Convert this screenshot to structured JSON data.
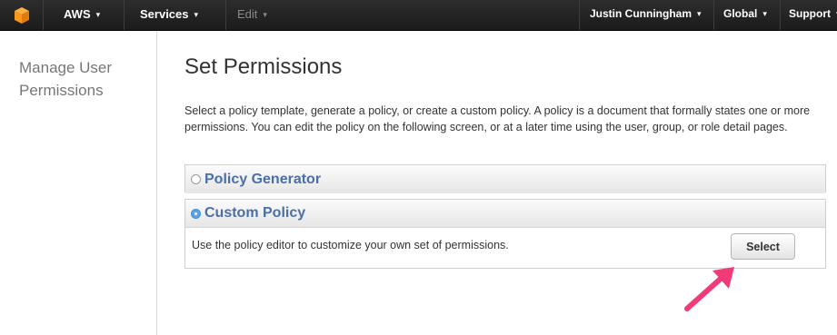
{
  "colors": {
    "nav_background": "#232323",
    "logo_orange": "#f7981d",
    "option_label": "#4a6fa8",
    "radio_selected": "#5aa3ea",
    "annotation_arrow": "#f03a7a"
  },
  "topnav": {
    "logo_icon": "aws-cube-icon",
    "aws_label": "AWS",
    "services_label": "Services",
    "edit_label": "Edit",
    "user_label": "Justin Cunningham",
    "region_label": "Global",
    "support_label": "Support",
    "caret": "▾"
  },
  "sidebar": {
    "title": "Manage User Permissions"
  },
  "main": {
    "title": "Set Permissions",
    "intro": "Select a policy template, generate a policy, or create a custom policy. A policy is a document that formally states one or more permissions. You can edit the policy on the following screen, or at a later time using the user, group, or role detail pages.",
    "options": [
      {
        "label": "Policy Generator",
        "selected": false
      },
      {
        "label": "Custom Policy",
        "selected": true,
        "description": "Use the policy editor to customize your own set of permissions.",
        "button_label": "Select"
      }
    ]
  },
  "annotation": {
    "icon": "arrow-pointer-icon"
  }
}
